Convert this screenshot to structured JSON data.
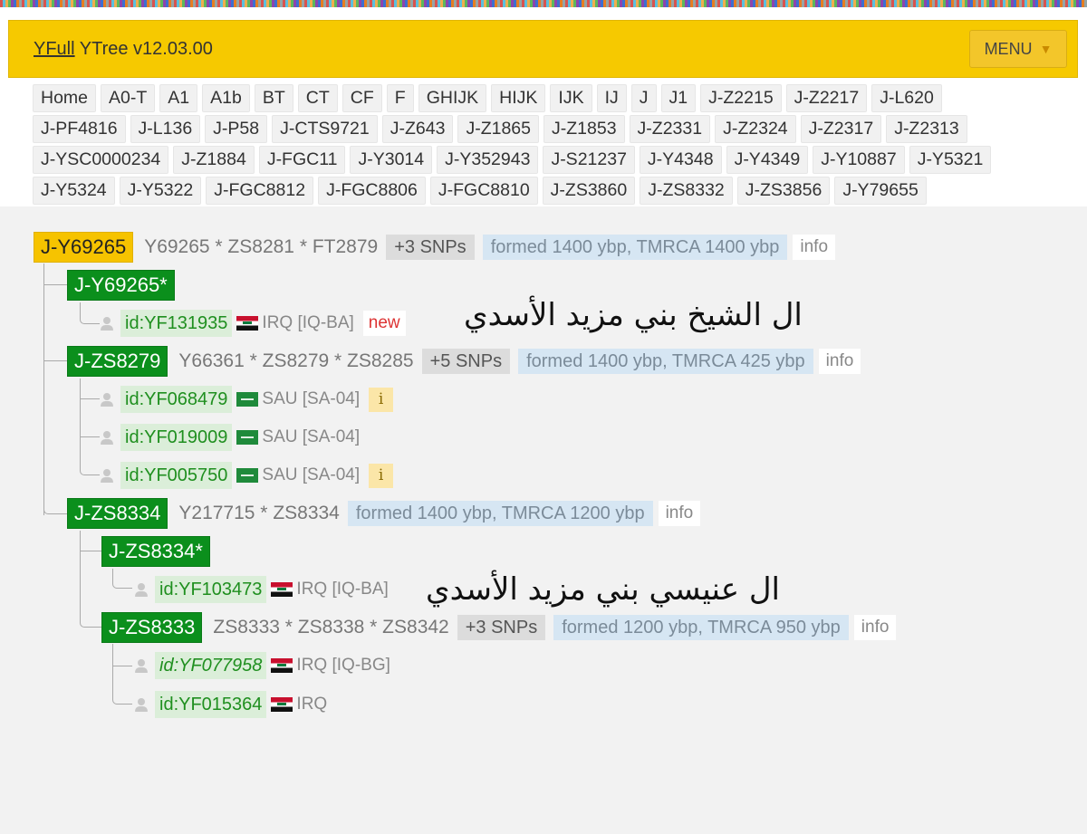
{
  "header": {
    "brand_link": "YFull",
    "brand_rest": " YTree v12.03.00",
    "menu_label": "MENU",
    "menu_caret": "▼"
  },
  "nav": {
    "rows": [
      [
        "Home",
        "A0-T",
        "A1",
        "A1b",
        "BT",
        "CT",
        "CF",
        "F",
        "GHIJK",
        "HIJK",
        "IJK",
        "IJ",
        "J",
        "J1",
        "J-Z2215",
        "J-Z2217",
        "J-L620"
      ],
      [
        "J-PF4816",
        "J-L136",
        "J-P58",
        "J-CTS9721",
        "J-Z643",
        "J-Z1865",
        "J-Z1853",
        "J-Z2331",
        "J-Z2324",
        "J-Z2317",
        "J-Z2313"
      ],
      [
        "J-YSC0000234",
        "J-Z1884",
        "J-FGC11",
        "J-Y3014",
        "J-Y352943",
        "J-S21237",
        "J-Y4348",
        "J-Y4349",
        "J-Y10887",
        "J-Y5321"
      ],
      [
        "J-Y5324",
        "J-Y5322",
        "J-FGC8812",
        "J-FGC8806",
        "J-FGC8810",
        "J-ZS3860",
        "J-ZS8332",
        "J-ZS3856",
        "J-Y79655"
      ]
    ]
  },
  "tree": {
    "root": {
      "name": "J-Y69265",
      "snps": "Y69265 * ZS8281 * FT2879",
      "more": "+3 SNPs",
      "formed": "formed 1400 ybp, TMRCA 1400 ybp",
      "info": "info"
    },
    "y69265_star": {
      "name": "J-Y69265*",
      "sample": {
        "id": "id:YF131935",
        "loc": "IRQ [IQ-BA]",
        "tag": "new"
      }
    },
    "zs8279": {
      "name": "J-ZS8279",
      "snps": "Y66361 * ZS8279 * ZS8285",
      "more": "+5 SNPs",
      "formed": "formed 1400 ybp, TMRCA 425 ybp",
      "info": "info",
      "samples": [
        {
          "id": "id:YF068479",
          "loc": "SAU [SA-04]",
          "i": "i"
        },
        {
          "id": "id:YF019009",
          "loc": "SAU [SA-04]"
        },
        {
          "id": "id:YF005750",
          "loc": "SAU [SA-04]",
          "i": "i"
        }
      ]
    },
    "zs8334": {
      "name": "J-ZS8334",
      "snps": "Y217715 * ZS8334",
      "formed": "formed 1400 ybp, TMRCA 1200 ybp",
      "info": "info"
    },
    "zs8334_star": {
      "name": "J-ZS8334*",
      "sample": {
        "id": "id:YF103473",
        "loc": "IRQ [IQ-BA]"
      }
    },
    "zs8333": {
      "name": "J-ZS8333",
      "snps": "ZS8333 * ZS8338 * ZS8342",
      "more": "+3 SNPs",
      "formed": "formed 1200 ybp, TMRCA 950 ybp",
      "info": "info",
      "samples": [
        {
          "id": "id:YF077958",
          "loc": "IRQ [IQ-BG]"
        },
        {
          "id": "id:YF015364",
          "loc": "IRQ"
        }
      ]
    }
  },
  "annotations": {
    "arabic_1": "ال الشيخ بني مزيد الأسدي",
    "arabic_2": "ال عنيسي بني مزيد الأسدي"
  }
}
